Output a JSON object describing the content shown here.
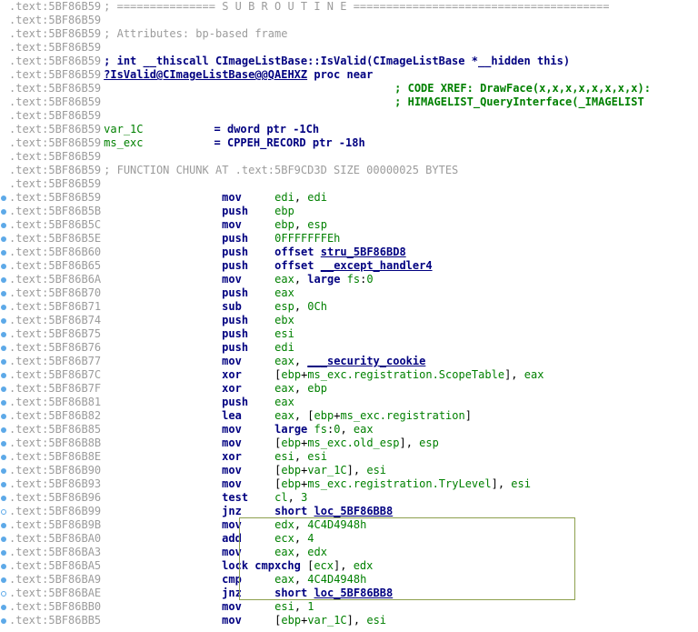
{
  "lines": [
    {
      "addr": ".text:5BF86B59",
      "c": "; =============== S U B R O U T I N E ======================================="
    },
    {
      "addr": ".text:5BF86B59",
      "c": ""
    },
    {
      "addr": ".text:5BF86B59",
      "c": "; Attributes: bp-based frame"
    },
    {
      "addr": ".text:5BF86B59",
      "c": ""
    },
    {
      "addr": ".text:5BF86B59",
      "sig": "; int __thiscall CImageListBase::IsValid(CImageListBase *__hidden this)"
    },
    {
      "addr": ".text:5BF86B59",
      "proc": "?IsValid@CImageListBase@@QAEHXZ proc near"
    },
    {
      "addr": ".text:5BF86B59",
      "xref": "; CODE XREF: DrawFace(x,x,x,x,x,x,x,x):"
    },
    {
      "addr": ".text:5BF86B59",
      "xref": "; HIMAGELIST_QueryInterface(_IMAGELIST"
    },
    {
      "addr": ".text:5BF86B59",
      "c": ""
    },
    {
      "addr": ".text:5BF86B59",
      "var": "var_1C",
      "eq": "= dword ptr -1Ch"
    },
    {
      "addr": ".text:5BF86B59",
      "var": "ms_exc",
      "eq": "= CPPEH_RECORD ptr -18h"
    },
    {
      "addr": ".text:5BF86B59",
      "c": ""
    },
    {
      "addr": ".text:5BF86B59",
      "c": "; FUNCTION CHUNK AT .text:5BF9CD3D SIZE 00000025 BYTES"
    },
    {
      "addr": ".text:5BF86B59",
      "c": ""
    },
    {
      "addr": ".text:5BF86B59",
      "mn": "mov",
      "ops": [
        {
          "t": "reg",
          "v": "edi"
        },
        {
          "t": "txt",
          "v": ", "
        },
        {
          "t": "reg",
          "v": "edi"
        }
      ],
      "dot": "s"
    },
    {
      "addr": ".text:5BF86B5B",
      "mn": "push",
      "ops": [
        {
          "t": "reg",
          "v": "ebp"
        }
      ],
      "dot": "s"
    },
    {
      "addr": ".text:5BF86B5C",
      "mn": "mov",
      "ops": [
        {
          "t": "reg",
          "v": "ebp"
        },
        {
          "t": "txt",
          "v": ", "
        },
        {
          "t": "reg",
          "v": "esp"
        }
      ],
      "dot": "s"
    },
    {
      "addr": ".text:5BF86B5E",
      "mn": "push",
      "ops": [
        {
          "t": "num",
          "v": "0FFFFFFFEh"
        }
      ],
      "dot": "s"
    },
    {
      "addr": ".text:5BF86B60",
      "mn": "push",
      "ops": [
        {
          "t": "str",
          "v": "offset"
        },
        {
          "t": "txt",
          "v": " "
        },
        {
          "t": "sym",
          "v": "stru_5BF86BD8"
        }
      ],
      "dot": "s"
    },
    {
      "addr": ".text:5BF86B65",
      "mn": "push",
      "ops": [
        {
          "t": "str",
          "v": "offset"
        },
        {
          "t": "txt",
          "v": " "
        },
        {
          "t": "sym",
          "v": "__except_handler4"
        }
      ],
      "dot": "s"
    },
    {
      "addr": ".text:5BF86B6A",
      "mn": "mov",
      "ops": [
        {
          "t": "reg",
          "v": "eax"
        },
        {
          "t": "txt",
          "v": ", "
        },
        {
          "t": "str",
          "v": "large"
        },
        {
          "t": "txt",
          "v": " "
        },
        {
          "t": "reg",
          "v": "fs"
        },
        {
          "t": "txt",
          "v": ":"
        },
        {
          "t": "num",
          "v": "0"
        }
      ],
      "dot": "s"
    },
    {
      "addr": ".text:5BF86B70",
      "mn": "push",
      "ops": [
        {
          "t": "reg",
          "v": "eax"
        }
      ],
      "dot": "s"
    },
    {
      "addr": ".text:5BF86B71",
      "mn": "sub",
      "ops": [
        {
          "t": "reg",
          "v": "esp"
        },
        {
          "t": "txt",
          "v": ", "
        },
        {
          "t": "num",
          "v": "0Ch"
        }
      ],
      "dot": "s"
    },
    {
      "addr": ".text:5BF86B74",
      "mn": "push",
      "ops": [
        {
          "t": "reg",
          "v": "ebx"
        }
      ],
      "dot": "s"
    },
    {
      "addr": ".text:5BF86B75",
      "mn": "push",
      "ops": [
        {
          "t": "reg",
          "v": "esi"
        }
      ],
      "dot": "s"
    },
    {
      "addr": ".text:5BF86B76",
      "mn": "push",
      "ops": [
        {
          "t": "reg",
          "v": "edi"
        }
      ],
      "dot": "s"
    },
    {
      "addr": ".text:5BF86B77",
      "mn": "mov",
      "ops": [
        {
          "t": "reg",
          "v": "eax"
        },
        {
          "t": "txt",
          "v": ", "
        },
        {
          "t": "sym",
          "v": "___security_cookie"
        }
      ],
      "dot": "s"
    },
    {
      "addr": ".text:5BF86B7C",
      "mn": "xor",
      "ops": [
        {
          "t": "txt",
          "v": "["
        },
        {
          "t": "reg",
          "v": "ebp"
        },
        {
          "t": "txt",
          "v": "+"
        },
        {
          "t": "reg",
          "v": "ms_exc.registration.ScopeTable"
        },
        {
          "t": "txt",
          "v": "], "
        },
        {
          "t": "reg",
          "v": "eax"
        }
      ],
      "dot": "s"
    },
    {
      "addr": ".text:5BF86B7F",
      "mn": "xor",
      "ops": [
        {
          "t": "reg",
          "v": "eax"
        },
        {
          "t": "txt",
          "v": ", "
        },
        {
          "t": "reg",
          "v": "ebp"
        }
      ],
      "dot": "s"
    },
    {
      "addr": ".text:5BF86B81",
      "mn": "push",
      "ops": [
        {
          "t": "reg",
          "v": "eax"
        }
      ],
      "dot": "s"
    },
    {
      "addr": ".text:5BF86B82",
      "mn": "lea",
      "ops": [
        {
          "t": "reg",
          "v": "eax"
        },
        {
          "t": "txt",
          "v": ", ["
        },
        {
          "t": "reg",
          "v": "ebp"
        },
        {
          "t": "txt",
          "v": "+"
        },
        {
          "t": "reg",
          "v": "ms_exc.registration"
        },
        {
          "t": "txt",
          "v": "]"
        }
      ],
      "dot": "s"
    },
    {
      "addr": ".text:5BF86B85",
      "mn": "mov",
      "ops": [
        {
          "t": "str",
          "v": "large"
        },
        {
          "t": "txt",
          "v": " "
        },
        {
          "t": "reg",
          "v": "fs"
        },
        {
          "t": "txt",
          "v": ":"
        },
        {
          "t": "num",
          "v": "0"
        },
        {
          "t": "txt",
          "v": ", "
        },
        {
          "t": "reg",
          "v": "eax"
        }
      ],
      "dot": "s"
    },
    {
      "addr": ".text:5BF86B8B",
      "mn": "mov",
      "ops": [
        {
          "t": "txt",
          "v": "["
        },
        {
          "t": "reg",
          "v": "ebp"
        },
        {
          "t": "txt",
          "v": "+"
        },
        {
          "t": "reg",
          "v": "ms_exc.old_esp"
        },
        {
          "t": "txt",
          "v": "], "
        },
        {
          "t": "reg",
          "v": "esp"
        }
      ],
      "dot": "s"
    },
    {
      "addr": ".text:5BF86B8E",
      "mn": "xor",
      "ops": [
        {
          "t": "reg",
          "v": "esi"
        },
        {
          "t": "txt",
          "v": ", "
        },
        {
          "t": "reg",
          "v": "esi"
        }
      ],
      "dot": "s"
    },
    {
      "addr": ".text:5BF86B90",
      "mn": "mov",
      "ops": [
        {
          "t": "txt",
          "v": "["
        },
        {
          "t": "reg",
          "v": "ebp"
        },
        {
          "t": "txt",
          "v": "+"
        },
        {
          "t": "reg",
          "v": "var_1C"
        },
        {
          "t": "txt",
          "v": "], "
        },
        {
          "t": "reg",
          "v": "esi"
        }
      ],
      "dot": "s"
    },
    {
      "addr": ".text:5BF86B93",
      "mn": "mov",
      "ops": [
        {
          "t": "txt",
          "v": "["
        },
        {
          "t": "reg",
          "v": "ebp"
        },
        {
          "t": "txt",
          "v": "+"
        },
        {
          "t": "reg",
          "v": "ms_exc.registration.TryLevel"
        },
        {
          "t": "txt",
          "v": "], "
        },
        {
          "t": "reg",
          "v": "esi"
        }
      ],
      "dot": "s"
    },
    {
      "addr": ".text:5BF86B96",
      "mn": "test",
      "ops": [
        {
          "t": "reg",
          "v": "cl"
        },
        {
          "t": "txt",
          "v": ", "
        },
        {
          "t": "num",
          "v": "3"
        }
      ],
      "dot": "s"
    },
    {
      "addr": ".text:5BF86B99",
      "mn": "jnz",
      "ops": [
        {
          "t": "str",
          "v": "short"
        },
        {
          "t": "txt",
          "v": " "
        },
        {
          "t": "sym",
          "v": "loc_5BF86BB8"
        }
      ],
      "dot": "h"
    },
    {
      "addr": ".text:5BF86B9B",
      "mn": "mov",
      "ops": [
        {
          "t": "reg",
          "v": "edx"
        },
        {
          "t": "txt",
          "v": ", "
        },
        {
          "t": "num",
          "v": "4C4D4948h"
        }
      ],
      "dot": "s"
    },
    {
      "addr": ".text:5BF86BA0",
      "mn": "add",
      "ops": [
        {
          "t": "reg",
          "v": "ecx"
        },
        {
          "t": "txt",
          "v": ", "
        },
        {
          "t": "num",
          "v": "4"
        }
      ],
      "dot": "s"
    },
    {
      "addr": ".text:5BF86BA3",
      "mn": "mov",
      "ops": [
        {
          "t": "reg",
          "v": "eax"
        },
        {
          "t": "txt",
          "v": ", "
        },
        {
          "t": "reg",
          "v": "edx"
        }
      ],
      "dot": "s"
    },
    {
      "addr": ".text:5BF86BA5",
      "mn2": "lock cmpxchg",
      "ops": [
        {
          "t": "txt",
          "v": "["
        },
        {
          "t": "reg",
          "v": "ecx"
        },
        {
          "t": "txt",
          "v": "], "
        },
        {
          "t": "reg",
          "v": "edx"
        }
      ],
      "dot": "s"
    },
    {
      "addr": ".text:5BF86BA9",
      "mn": "cmp",
      "ops": [
        {
          "t": "reg",
          "v": "eax"
        },
        {
          "t": "txt",
          "v": ", "
        },
        {
          "t": "num",
          "v": "4C4D4948h"
        }
      ],
      "dot": "s"
    },
    {
      "addr": ".text:5BF86BAE",
      "mn": "jnz",
      "ops": [
        {
          "t": "str",
          "v": "short"
        },
        {
          "t": "txt",
          "v": " "
        },
        {
          "t": "sym",
          "v": "loc_5BF86BB8"
        }
      ],
      "dot": "h"
    },
    {
      "addr": ".text:5BF86BB0",
      "mn": "mov",
      "ops": [
        {
          "t": "reg",
          "v": "esi"
        },
        {
          "t": "txt",
          "v": ", "
        },
        {
          "t": "num",
          "v": "1"
        }
      ],
      "dot": "s"
    },
    {
      "addr": ".text:5BF86BB5",
      "mn": "mov",
      "ops": [
        {
          "t": "txt",
          "v": "["
        },
        {
          "t": "reg",
          "v": "ebp"
        },
        {
          "t": "txt",
          "v": "+"
        },
        {
          "t": "reg",
          "v": "var_1C"
        },
        {
          "t": "txt",
          "v": "], "
        },
        {
          "t": "reg",
          "v": "esi"
        }
      ],
      "dot": "s"
    }
  ]
}
